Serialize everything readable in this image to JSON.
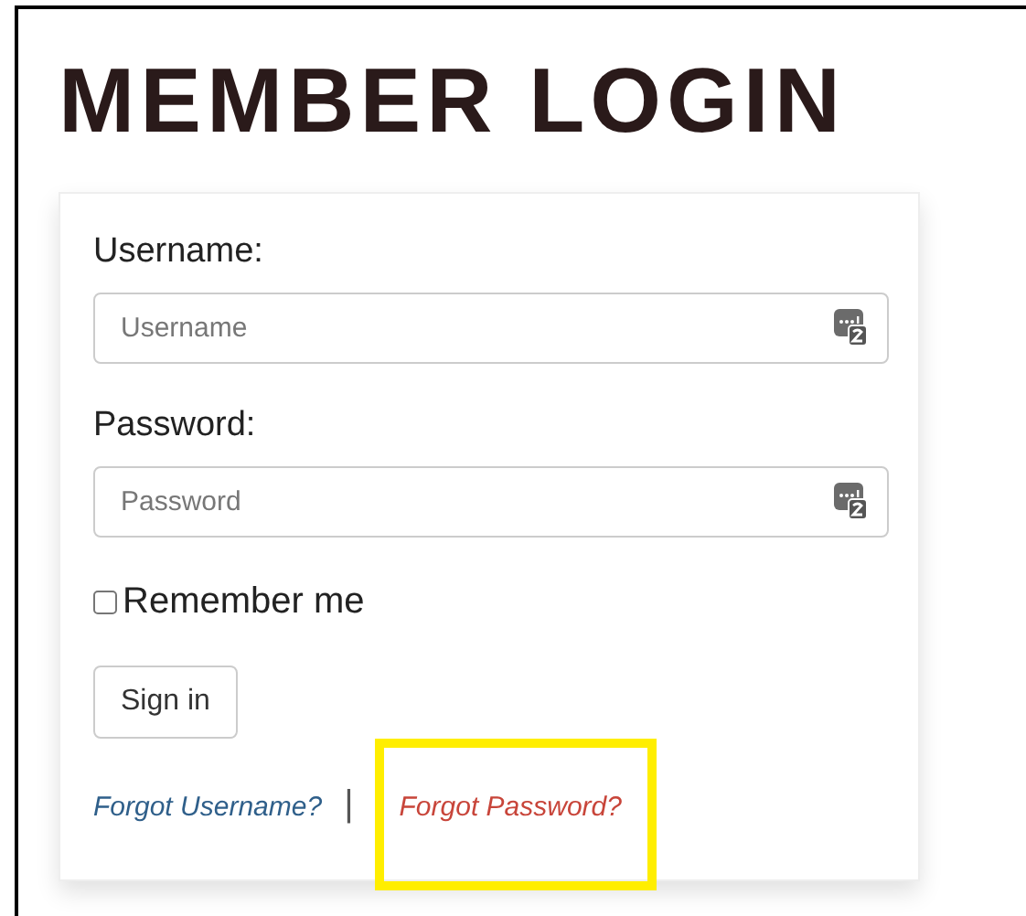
{
  "title": "MEMBER LOGIN",
  "fields": [
    {
      "label": "Username:",
      "placeholder": "Username"
    },
    {
      "label": "Password:",
      "placeholder": "Password"
    }
  ],
  "remember": {
    "label": "Remember me",
    "checked": false
  },
  "sign_in": "Sign in",
  "links": [
    {
      "label": "Forgot Username?",
      "color": "#2f5f8a",
      "highlighted": false
    },
    {
      "label": "Forgot Password?",
      "color": "#c8453a",
      "highlighted": true
    }
  ],
  "separator": "|"
}
